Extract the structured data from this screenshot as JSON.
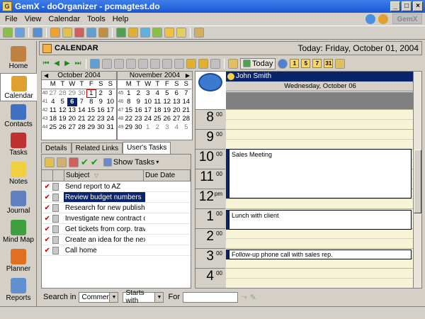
{
  "window": {
    "title": "GemX - doOrganizer  -  pcmagtest.do",
    "logo": "GemX"
  },
  "menu": [
    "File",
    "View",
    "Calendar",
    "Tools",
    "Help"
  ],
  "nav": [
    {
      "label": "Home",
      "icon": "home-icon",
      "color": "#c08040"
    },
    {
      "label": "Calendar",
      "icon": "calendar-icon",
      "color": "#e0a030"
    },
    {
      "label": "Contacts",
      "icon": "contacts-icon",
      "color": "#4070c0"
    },
    {
      "label": "Tasks",
      "icon": "tasks-icon",
      "color": "#c03030"
    },
    {
      "label": "Notes",
      "icon": "notes-icon",
      "color": "#f0d040"
    },
    {
      "label": "Journal",
      "icon": "journal-icon",
      "color": "#6080c0"
    },
    {
      "label": "Mind Map",
      "icon": "mindmap-icon",
      "color": "#40a040"
    },
    {
      "label": "Planner",
      "icon": "planner-icon",
      "color": "#e07020"
    },
    {
      "label": "Reports",
      "icon": "reports-icon",
      "color": "#6090d0"
    }
  ],
  "calendar": {
    "title": "CALENDAR",
    "today_label": "Today: Friday, October 01, 2004",
    "today_button": "Today",
    "day_buttons": [
      "1",
      "5",
      "7",
      "31"
    ]
  },
  "minicals": [
    {
      "title": "October 2004",
      "days_header": [
        "M",
        "T",
        "W",
        "T",
        "F",
        "S",
        "S"
      ],
      "weeks": [
        {
          "wk": "40",
          "days": [
            "27",
            "28",
            "29",
            "30",
            "1",
            "2",
            "3"
          ]
        },
        {
          "wk": "41",
          "days": [
            "4",
            "5",
            "6",
            "7",
            "8",
            "9",
            "10"
          ]
        },
        {
          "wk": "42",
          "days": [
            "11",
            "12",
            "13",
            "14",
            "15",
            "16",
            "17"
          ]
        },
        {
          "wk": "43",
          "days": [
            "18",
            "19",
            "20",
            "21",
            "22",
            "23",
            "24"
          ]
        },
        {
          "wk": "44",
          "days": [
            "25",
            "26",
            "27",
            "28",
            "29",
            "30",
            "31"
          ]
        }
      ]
    },
    {
      "title": "November 2004",
      "days_header": [
        "M",
        "T",
        "W",
        "T",
        "F",
        "S",
        "S"
      ],
      "weeks": [
        {
          "wk": "45",
          "days": [
            "1",
            "2",
            "3",
            "4",
            "5",
            "6",
            "7"
          ]
        },
        {
          "wk": "46",
          "days": [
            "8",
            "9",
            "10",
            "11",
            "12",
            "13",
            "14"
          ]
        },
        {
          "wk": "47",
          "days": [
            "15",
            "16",
            "17",
            "18",
            "19",
            "20",
            "21"
          ]
        },
        {
          "wk": "48",
          "days": [
            "22",
            "23",
            "24",
            "25",
            "26",
            "27",
            "28"
          ]
        },
        {
          "wk": "49",
          "days": [
            "29",
            "30",
            "1",
            "2",
            "3",
            "4",
            "5"
          ]
        }
      ]
    }
  ],
  "tabs": [
    "Details",
    "Related Links",
    "User's Tasks"
  ],
  "tasks": {
    "show_tasks_label": "Show Tasks",
    "columns": [
      "Subject",
      "Due Date"
    ],
    "rows": [
      "Send report to AZ",
      "Review budget numbers",
      "Research for new publishers",
      "Investigate new contract o...",
      "Get tickets from corp. trav...",
      "Create an idea for the nex...",
      "Call home"
    ]
  },
  "search": {
    "label": "Search in",
    "field": "Comments",
    "mode": "Starts with",
    "for_label": "For"
  },
  "dayview": {
    "owner": "John Smith",
    "date": "Wednesday, October 06",
    "hours": [
      {
        "hr": "8",
        "mn": "00"
      },
      {
        "hr": "9",
        "mn": "00"
      },
      {
        "hr": "10",
        "mn": "00"
      },
      {
        "hr": "11",
        "mn": "00"
      },
      {
        "hr": "12",
        "mn": "pm"
      },
      {
        "hr": "1",
        "mn": "00"
      },
      {
        "hr": "2",
        "mn": "00"
      },
      {
        "hr": "3",
        "mn": "00"
      },
      {
        "hr": "4",
        "mn": "00"
      }
    ],
    "appointments": [
      {
        "title": "Sales Meeting"
      },
      {
        "title": "Lunch with client"
      },
      {
        "title": "Follow-up phone call with sales rep."
      }
    ]
  }
}
